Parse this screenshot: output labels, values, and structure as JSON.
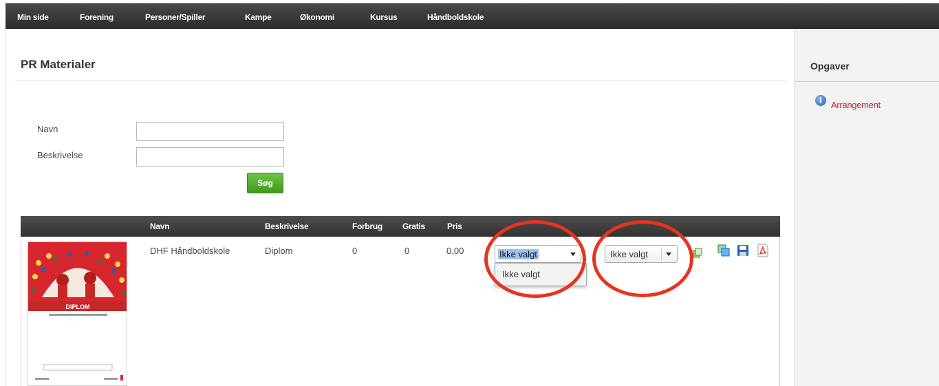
{
  "nav": {
    "items": [
      "Min side",
      "Forening",
      "Personer/Spiller",
      "Kampe",
      "Økonomi",
      "Kursus",
      "Håndboldskole"
    ]
  },
  "page": {
    "title": "PR Materialer"
  },
  "form": {
    "name_label": "Navn",
    "name_value": "",
    "description_label": "Beskrivelse",
    "description_value": "",
    "search_button": "Søg"
  },
  "table": {
    "headers": [
      "Navn",
      "Beskrivelse",
      "Forbrug",
      "Gratis",
      "Pris"
    ],
    "rows": [
      {
        "name": "DHF Håndboldskole",
        "description": "Diplom",
        "usage": "0",
        "free": "0",
        "price": "0,00",
        "select1_value": "Ikke valgt",
        "select1_options": [
          "Ikke valgt"
        ],
        "select2_value": "Ikke valgt",
        "thumbnail_title": "DIPLOM"
      }
    ]
  },
  "sidebar": {
    "title": "Opgaver",
    "link": "Arrangement"
  },
  "colors": {
    "highlight_circle": "#e8331f",
    "search_button": "#4fae2a",
    "link": "#c2272d"
  },
  "icons": [
    "info-icon",
    "copy-icon",
    "save-icon",
    "pdf-icon",
    "duplicate-icon"
  ]
}
